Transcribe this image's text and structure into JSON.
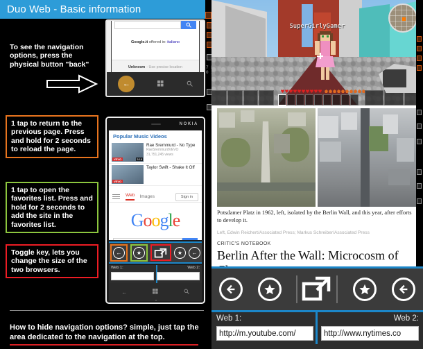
{
  "window": {
    "title": "Duo Web - Basic information",
    "titlebar_color": "#2d9cd8"
  },
  "annotations": {
    "intro": "To see the navigation options, press the physical button \"back\"",
    "back_button": "1 tap to return to the previous page. Press and hold for 2 seconds to reload the page.",
    "favorites_button": "1 tap to open the favorites list. Press and hold for 2 seconds to add the site in the favorites list.",
    "toggle_button": "Toggle key, lets you change the size of the two browsers.",
    "hide_nav": "How to hide navigation options? simple, just tap the area dedicated to the navigation at the top.",
    "colors": {
      "back": "#e8741e",
      "favorites": "#8cc63e",
      "toggle": "#ed1c24",
      "underline": "#d81f23"
    }
  },
  "phone_top": {
    "search_placeholder": "",
    "offered_prefix": "Google.it",
    "offered_middle": "offered in:",
    "offered_language": "italiano",
    "location_label": "Unknown",
    "location_action": "- Use precise location",
    "nav": {
      "back": "←",
      "home": "windows-glyph",
      "search": "⚲"
    }
  },
  "phone_main": {
    "brand": "NOKIA",
    "youtube": {
      "heading": "Popular Music Videos",
      "videos": [
        {
          "title": "Rae Sremmurd - No Type",
          "channel": "RaeSremmurdVEVO",
          "views": "31,751,245 views",
          "duration": "3:18",
          "badge": "VEVO"
        },
        {
          "title": "Taylor Swift - Shake It Off",
          "channel": "",
          "views": "",
          "duration": "",
          "badge": "VEVO"
        }
      ]
    },
    "google": {
      "tab_web": "Web",
      "tab_images": "Images",
      "sign_in": "Sign in",
      "logo": "Google",
      "search_value": ""
    },
    "duo_labels": {
      "web1": "Web 1:",
      "web2": "Web 2:"
    }
  },
  "minecraft": {
    "gamertag": "SuperGirlyGamer",
    "hearts": 10,
    "armor": 10,
    "hotbar_slots": 9
  },
  "nytimes": {
    "caption": "Potsdamer Platz in 1962, left, isolated by the Berlin Wall, and this year, after efforts to develop it.",
    "credit": "Left, Edwin Reichert/Associated Press; Markus Schreiber/Associated Press",
    "kicker": "CRITIC'S NOTEBOOK",
    "headline": "Berlin After the Wall: Microcosm of Change"
  },
  "duo_bar": {
    "accent_color": "#1c87c9",
    "background": "#3b3b3b",
    "buttons": [
      {
        "name": "back-left",
        "icon": "arrow-left-circle"
      },
      {
        "name": "favorites-left",
        "icon": "star-circle"
      },
      {
        "name": "toggle",
        "icon": "expand-arrow"
      },
      {
        "name": "favorites-right",
        "icon": "star-circle"
      },
      {
        "name": "back-right",
        "icon": "arrow-left-circle"
      }
    ]
  },
  "url_bar": {
    "web1_label": "Web 1:",
    "web2_label": "Web 2:",
    "web1_value": "http://m.youtube.com/",
    "web2_value": "http://www.nytimes.co"
  }
}
